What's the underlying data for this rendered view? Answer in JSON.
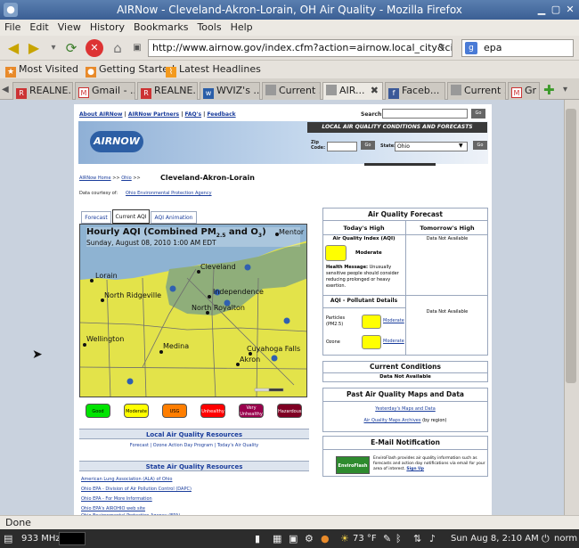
{
  "window": {
    "title": "AIRNow - Cleveland-Akron-Lorain, OH Air Quality - Mozilla Firefox"
  },
  "menu": [
    "File",
    "Edit",
    "View",
    "History",
    "Bookmarks",
    "Tools",
    "Help"
  ],
  "url": "http://www.airnow.gov/index.cfm?action=airnow.local_city&cityid=",
  "search": {
    "value": "epa"
  },
  "bookmarks": [
    "Most Visited",
    "Getting Started",
    "Latest Headlines"
  ],
  "tabs": [
    "REALNE...",
    "Gmail - ...",
    "REALNE...",
    "WVIZ's ...",
    "Current ...",
    "AIR...",
    "Faceb...",
    "Current ...",
    "Gr"
  ],
  "status": "Done",
  "taskbar": {
    "cpu": "933 MHz",
    "temp": "73 °F",
    "clock": "Sun Aug  8,  2:10 AM",
    "user": "norm"
  },
  "site": {
    "toplinks": {
      "about": "About AIRNow",
      "partners": "AIRNow Partners",
      "faqs": "FAQ's",
      "feedback": "Feedback"
    },
    "search_label": "Search:",
    "go": "Go",
    "logo": "AIRNOW",
    "banner": "LOCAL AIR QUALITY CONDITIONS AND FORECASTS",
    "zip_label": "Zip Code:",
    "state_label": "State:",
    "state_value": "Ohio",
    "breadcrumb_home": "AIRNow Home",
    "breadcrumb_state": "Ohio",
    "city_title": "Cleveland-Akron-Lorain",
    "data_courtesy": "Data courtesy of:",
    "data_source": "Ohio Environmental Protection Agency",
    "tabs": [
      "Forecast",
      "Current AQI",
      "AQI Animation"
    ],
    "map": {
      "title": "Hourly AQI (Combined PM",
      "title_sub": "2.5",
      "title_mid": " and O",
      "title_sub2": "3",
      "title_end": ")",
      "date": "Sunday, August 08, 2010 1:00 AM EDT",
      "cities": [
        "Mentor",
        "Lorain",
        "Cleveland",
        "North Ridgeville",
        "Independence",
        "North Royalton",
        "Wellington",
        "Medina",
        "Cuyahoga Falls",
        "Akron"
      ]
    },
    "legend": [
      "Good",
      "Moderate",
      "USG",
      "Unhealthy",
      "Very Unhealthy",
      "Hazardous"
    ],
    "legend_colors": [
      "#00e400",
      "#ffff00",
      "#ff7e00",
      "#ff0000",
      "#99004c",
      "#7e0023"
    ],
    "local_resources": "Local Air Quality Resources",
    "local_links": "Forecast | Ozone Action Day Program | Today's Air Quality",
    "state_resources": "State Air Quality Resources",
    "state_links": [
      "American Lung Association (ALA) of Ohio",
      "Ohio EPA - Division of Air Pollution Control (DAPC)",
      "Ohio EPA - For More Information",
      "Ohio EPA's AIROHIO web site",
      "Ohio Environmental Protection Agency (EPA)"
    ],
    "forecast": {
      "header": "Air Quality Forecast",
      "today": "Today's High",
      "tomorrow": "Tomorrow's High",
      "aqi_label": "Air Quality Index (AQI)",
      "aqi_value": "Moderate",
      "not_available": "Data Not Available",
      "health_label": "Health Message:",
      "health_text": "Unusually sensitive people should consider reducing prolonged or heavy exertion.",
      "pollutant_header": "AQI - Pollutant Details",
      "particles": "Particles (PM2.5)",
      "ozone": "Ozone",
      "moderate": "Moderate"
    },
    "current": {
      "header": "Current Conditions",
      "value": "Data Not Available"
    },
    "past": {
      "header": "Past Air Quality Maps and Data",
      "link1": "Yesterday's Maps and Data",
      "link2": "Air Quality Maps Archives",
      "link2_suffix": "(by region)"
    },
    "email": {
      "header": "E-Mail Notification",
      "logo": "EnviroFlash",
      "text": "EnviroFlash provides air quality information such as forecasts and action day notifications via email for your area of interest.",
      "signup": "Sign Up"
    }
  }
}
